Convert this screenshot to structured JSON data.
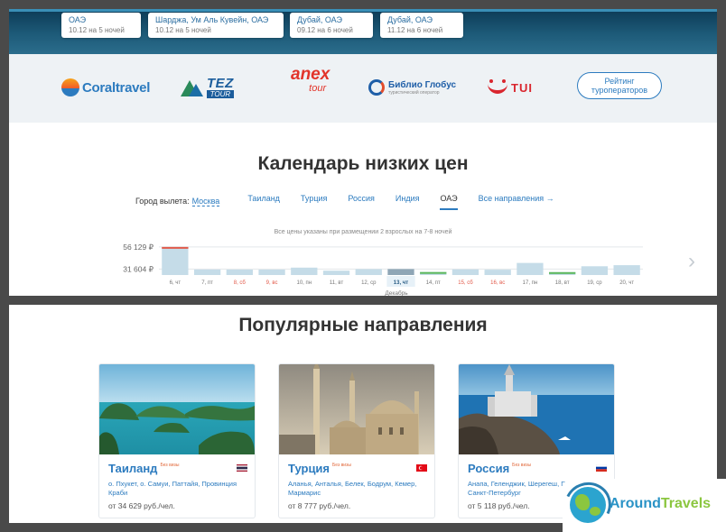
{
  "hero": {
    "destinations": [
      {
        "name": "ОАЭ",
        "sub": "10.12 на 5 ночей"
      },
      {
        "name": "Шарджа, Ум Аль Кувейн, ОАЭ",
        "sub": "10.12 на 5 ночей"
      },
      {
        "name": "Дубай, ОАЭ",
        "sub": "09.12 на 6 ночей"
      },
      {
        "name": "Дубай, ОАЭ",
        "sub": "11.12 на 6 ночей"
      }
    ]
  },
  "operators": {
    "coral": "Coraltravel",
    "tez": "TEZ",
    "tez_sub": "TOUR",
    "anex": "anex",
    "anex_sub": "tour",
    "biblio": "Библио Глобус",
    "biblio_sub": "туристический оператор",
    "tui": "TUI",
    "rating_button": "Рейтинг туроператоров"
  },
  "calendar": {
    "title": "Календарь низких цен",
    "city_label": "Город вылета:",
    "city_value": "Москва",
    "tabs": [
      "Таиланд",
      "Турция",
      "Россия",
      "Индия",
      "ОАЭ"
    ],
    "active_tab": "ОАЭ",
    "all_directions": "Все направления →",
    "note": "Все цены указаны при размещении 2 взрослых на 7-8 ночей",
    "next_icon": "chevron-right-icon"
  },
  "chart_data": {
    "type": "bar",
    "y_ticks": [
      "56 129 ₽",
      "31 604 ₽"
    ],
    "y_tick_values": [
      56129,
      31604
    ],
    "ylim": [
      25000,
      58000
    ],
    "month_label": "Декабрь",
    "selected": "13, чт",
    "categories": [
      "6, чт",
      "7, пт",
      "8, сб",
      "9, вс",
      "10, пн",
      "11, вт",
      "12, ср",
      "13, чт",
      "14, пт",
      "15, сб",
      "16, вс",
      "17, пн",
      "18, вт",
      "19, ср",
      "20, чт"
    ],
    "weekend": [
      false,
      false,
      true,
      true,
      false,
      false,
      false,
      false,
      false,
      true,
      true,
      false,
      false,
      false,
      false
    ],
    "values": [
      56129,
      31100,
      31000,
      31000,
      33200,
      29800,
      31500,
      31600,
      28300,
      31300,
      30900,
      38400,
      28200,
      34700,
      35900
    ],
    "highlight": {
      "max_color": "#e25a4a",
      "min_color": "#5cb85c"
    }
  },
  "popular": {
    "title": "Популярные направления",
    "cards": [
      {
        "name": "Таиланд",
        "visa": "Без визы",
        "cities": "о. Пхукет, о. Самуи, Паттайя, Провинция Краби",
        "price": "от 34 629 руб./чел.",
        "flag": "thailand-flag-icon"
      },
      {
        "name": "Турция",
        "visa": "Без визы",
        "cities": "Аланья, Анталья, Белек, Бодрум, Кемер, Мармарис",
        "price": "от 8 777 руб./чел.",
        "flag": "turkey-flag-icon"
      },
      {
        "name": "Россия",
        "visa": "Без визы",
        "cities": "Анапа, Геленджик, Шерегеш, Приэльбрусье, Санкт-Петербург",
        "price": "от 5 118 руб./чел.",
        "flag": "russia-flag-icon"
      }
    ]
  },
  "watermark": {
    "brand_a": "Around",
    "brand_b": "Travels"
  }
}
